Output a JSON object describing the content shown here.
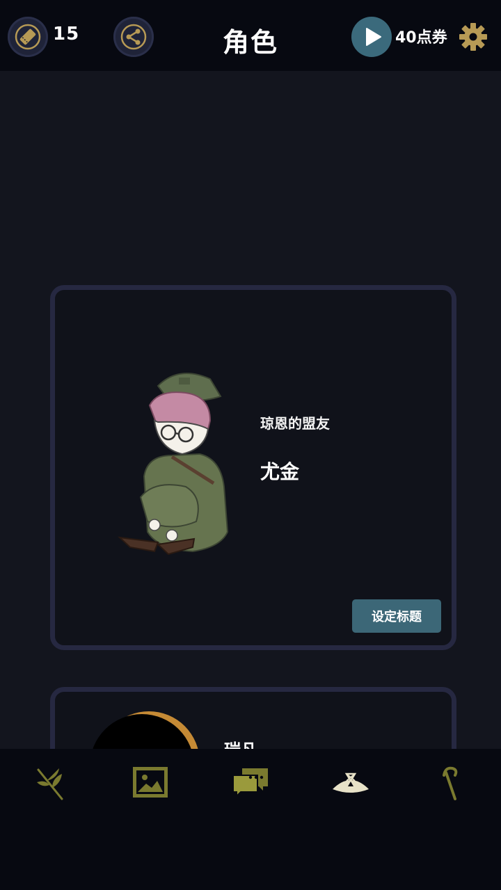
{
  "header": {
    "ticket_count": "15",
    "title": "角色",
    "voucher_label": "40点券",
    "icons": {
      "ticket": "ticket-icon",
      "share": "share-icon",
      "play": "play-icon",
      "settings": "gear-icon"
    }
  },
  "cards": [
    {
      "subtitle": "琼恩的盟友",
      "name": "尤金",
      "button_label": "设定标题"
    },
    {
      "name": "瑞凡"
    }
  ],
  "bottom_nav": {
    "items": [
      {
        "icon": "sprout-icon"
      },
      {
        "icon": "gallery-icon"
      },
      {
        "icon": "chat-icon"
      },
      {
        "icon": "tent-icon"
      },
      {
        "icon": "cane-icon"
      }
    ]
  },
  "colors": {
    "background": "#13151e",
    "bar": "#070911",
    "accent_gold": "#b79a55",
    "accent_teal": "#3c6777",
    "card_border": "#262841"
  }
}
